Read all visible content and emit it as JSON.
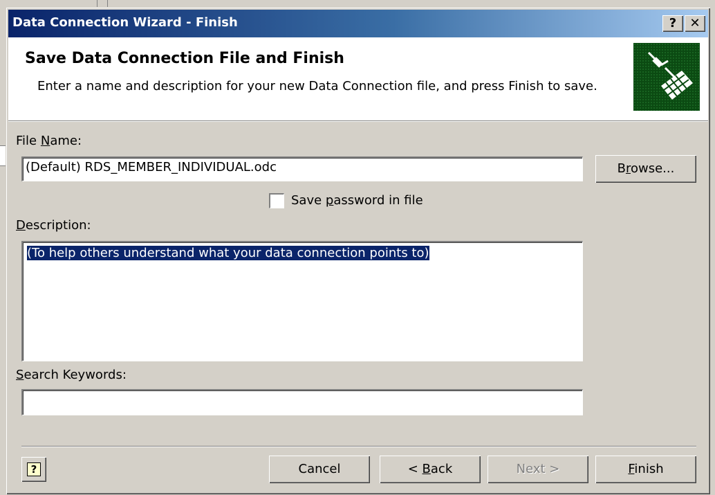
{
  "window": {
    "title": "Data Connection Wizard - Finish",
    "help_button": "?",
    "close_button": "✕"
  },
  "header": {
    "title": "Save Data Connection File and Finish",
    "description": "Enter a name and description for your new Data Connection file, and press Finish to save."
  },
  "form": {
    "file_name_label_pre": "File ",
    "file_name_label_access": "N",
    "file_name_label_post": "ame:",
    "file_name_value": "(Default) RDS_MEMBER_INDIVIDUAL.odc",
    "browse_pre": "B",
    "browse_access": "r",
    "browse_post": "owse...",
    "save_password_pre": "Save ",
    "save_password_access": "p",
    "save_password_post": "assword in file",
    "save_password_checked": false,
    "description_label_access": "D",
    "description_label_post": "escription:",
    "description_value": "(To help others understand what your data connection points to)",
    "keywords_label_access": "S",
    "keywords_label_post": "earch Keywords:",
    "keywords_value": ""
  },
  "footer": {
    "cancel": "Cancel",
    "back_pre": "< ",
    "back_access": "B",
    "back_post": "ack",
    "next": "Next >",
    "finish_access": "F",
    "finish_post": "inish",
    "help_icon_text": "?"
  }
}
